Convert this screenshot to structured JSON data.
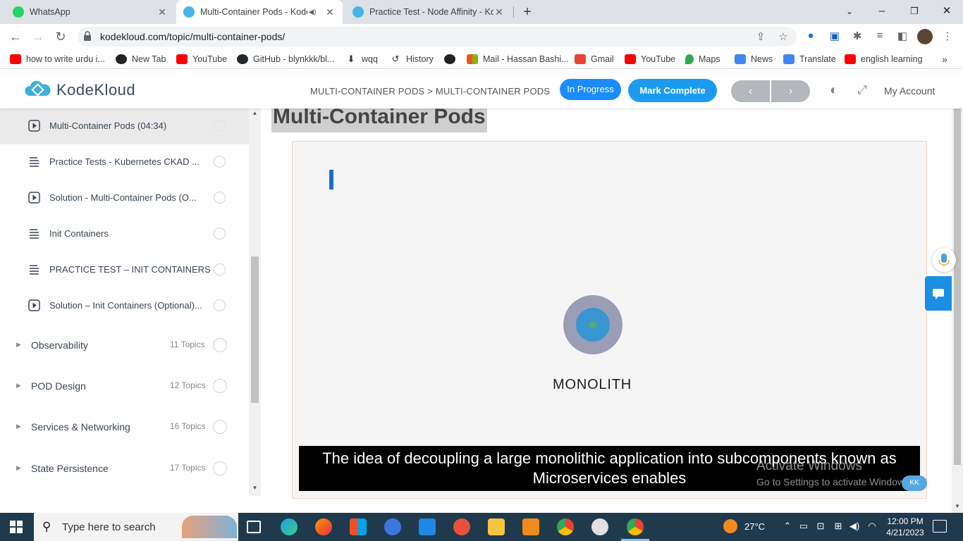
{
  "browser": {
    "tabs": [
      {
        "title": "WhatsApp",
        "favicon": "whatsapp-icon",
        "color": "#25d366",
        "active": false
      },
      {
        "title": "Multi-Container Pods - Kode",
        "favicon": "kodekloud-icon",
        "color": "#4bb4e6",
        "active": true
      },
      {
        "title": "Practice Test - Node Affinity - Ko",
        "favicon": "kodekloud-icon",
        "color": "#4bb4e6",
        "active": false
      }
    ],
    "url": "kodekloud.com/topic/multi-container-pods/",
    "bookmarks": [
      {
        "label": "how to write urdu i...",
        "icon": "youtube-icon",
        "color": "#ff0000"
      },
      {
        "label": "New Tab",
        "icon": "globe-icon",
        "color": "#202124"
      },
      {
        "label": "YouTube",
        "icon": "youtube-icon",
        "color": "#ff0000"
      },
      {
        "label": "GitHub - blynkkk/bl...",
        "icon": "github-icon",
        "color": "#24292e"
      },
      {
        "label": "wqq",
        "icon": "download-icon",
        "color": "#333333"
      },
      {
        "label": "History",
        "icon": "history-icon",
        "color": "#333333"
      },
      {
        "label": "",
        "icon": "globe-icon",
        "color": "#202124"
      },
      {
        "label": "Mail - Hassan Bashi...",
        "icon": "microsoft-icon",
        "color": "#f25022"
      },
      {
        "label": "Gmail",
        "icon": "gmail-icon",
        "color": "#ea4335"
      },
      {
        "label": "YouTube",
        "icon": "youtube-icon",
        "color": "#ff0000"
      },
      {
        "label": "Maps",
        "icon": "maps-icon",
        "color": "#34a853"
      },
      {
        "label": "News",
        "icon": "news-icon",
        "color": "#4285f4"
      },
      {
        "label": "Translate",
        "icon": "translate-icon",
        "color": "#4285f4"
      },
      {
        "label": "english learning",
        "icon": "youtube-icon",
        "color": "#ff0000"
      }
    ]
  },
  "header": {
    "logo_text": "KodeKloud",
    "breadcrumb": "MULTI-CONTAINER PODS > MULTI-CONTAINER PODS",
    "status_label": "In Progress",
    "complete_label": "Mark Complete",
    "prev_label": "‹",
    "next_label": "›",
    "account_label": "My Account"
  },
  "sidebar": {
    "lessons": [
      {
        "label": "Multi-Container Pods (04:34)",
        "type": "video",
        "current": true
      },
      {
        "label": "Practice Tests - Kubernetes CKAD ...",
        "type": "text",
        "current": false
      },
      {
        "label": "Solution - Multi-Container Pods (O...",
        "type": "video",
        "current": false
      },
      {
        "label": "Init Containers",
        "type": "text",
        "current": false
      },
      {
        "label": "PRACTICE TEST – INIT CONTAINERS",
        "type": "text",
        "current": false
      },
      {
        "label": "Solution – Init Containers (Optional)...",
        "type": "video",
        "current": false
      }
    ],
    "sections": [
      {
        "label": "Observability",
        "count": "11 Topics"
      },
      {
        "label": "POD Design",
        "count": "12 Topics"
      },
      {
        "label": "Services & Networking",
        "count": "16 Topics"
      },
      {
        "label": "State Persistence",
        "count": "17 Topics"
      }
    ]
  },
  "main": {
    "title": "Multi-Container Pods",
    "video": {
      "diagram_label": "MONOLITH",
      "caption_line1": "The idea of decoupling a large monolithic application into subcomponents known as",
      "caption_line2": "Microservices enables",
      "watermark_line1": "Activate Windows",
      "watermark_line2": "Go to Settings to activate Windows.",
      "badge": "KK"
    }
  },
  "taskbar": {
    "search_placeholder": "Type here to search",
    "weather": "27°C",
    "time": "12:00 PM",
    "date": "4/21/2023"
  }
}
